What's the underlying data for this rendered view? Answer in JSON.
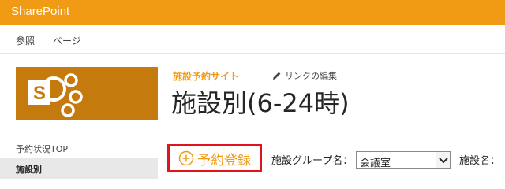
{
  "suitebar": {
    "brand": "SharePoint",
    "color": "#f19b15"
  },
  "ribbon": {
    "tabs": [
      {
        "label": "参照"
      },
      {
        "label": "ページ"
      }
    ]
  },
  "header": {
    "site_link": "施設予約サイト",
    "edit_links": "リンクの編集",
    "page_title": "施設別(6-24時)",
    "logo_icon": "sharepoint-logo",
    "logo_color": "#c57a0e"
  },
  "leftnav": {
    "items": [
      {
        "label": "予約状況TOP"
      },
      {
        "label": "施設別",
        "selected": true
      }
    ]
  },
  "toolbar": {
    "reserve_button": "予約登録",
    "group_label": "施設グループ名：",
    "group_value": "会議室",
    "facility_label": "施設名："
  }
}
